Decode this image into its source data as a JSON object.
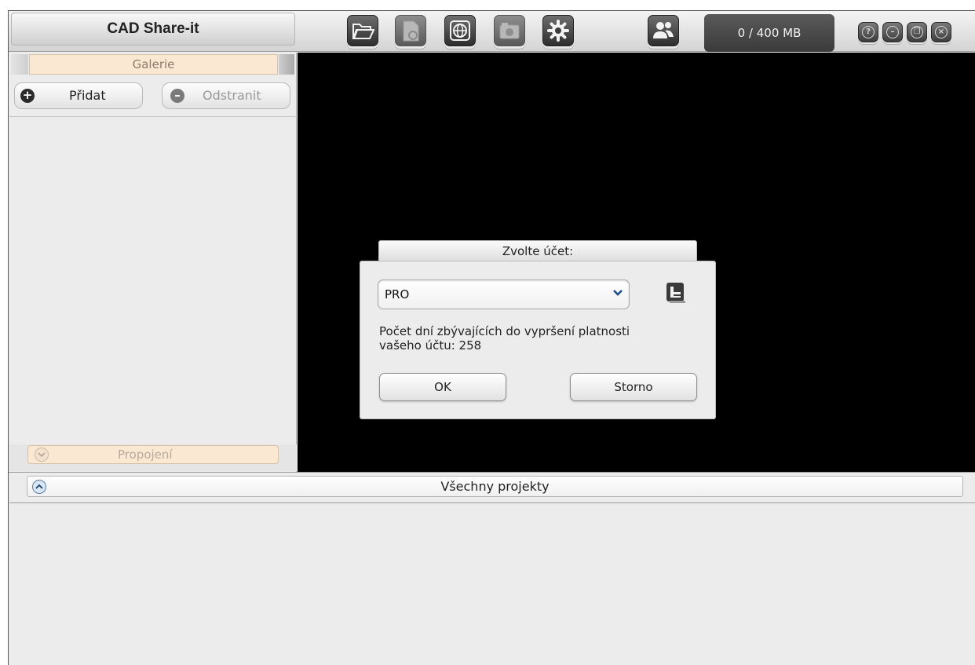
{
  "window": {
    "title": "CAD Share-it"
  },
  "toolbar": {
    "buttons": [
      {
        "icon": "folder-open-icon",
        "enabled": true
      },
      {
        "icon": "document-icon",
        "enabled": false
      },
      {
        "icon": "globe-icon",
        "enabled": true
      },
      {
        "icon": "camera-icon",
        "enabled": false
      },
      {
        "icon": "gear-icon",
        "enabled": true
      },
      {
        "icon": "users-icon",
        "enabled": true
      }
    ],
    "storage": "0 / 400 MB"
  },
  "window_controls": {
    "help": "?",
    "minimize": "–",
    "restore": "❐",
    "close": "×"
  },
  "gallery": {
    "tab_label": "Galerie",
    "add_label": "Přidat",
    "remove_label": "Odstranit"
  },
  "connections": {
    "tab_label": "Propojení"
  },
  "dialog": {
    "title": "Zvolte účet:",
    "selected_account": "PRO",
    "days_text_line1": "Počet dní zbývajících do vypršení platnosti",
    "days_text_line2": "vašeho účtu: 258",
    "ok_label": "OK",
    "cancel_label": "Storno"
  },
  "projects": {
    "tab_label": "Všechny projekty"
  },
  "colors": {
    "tab_accent": "#fbe8d2",
    "canvas": "#000000",
    "toolbar_button": "#3c3c3c"
  }
}
